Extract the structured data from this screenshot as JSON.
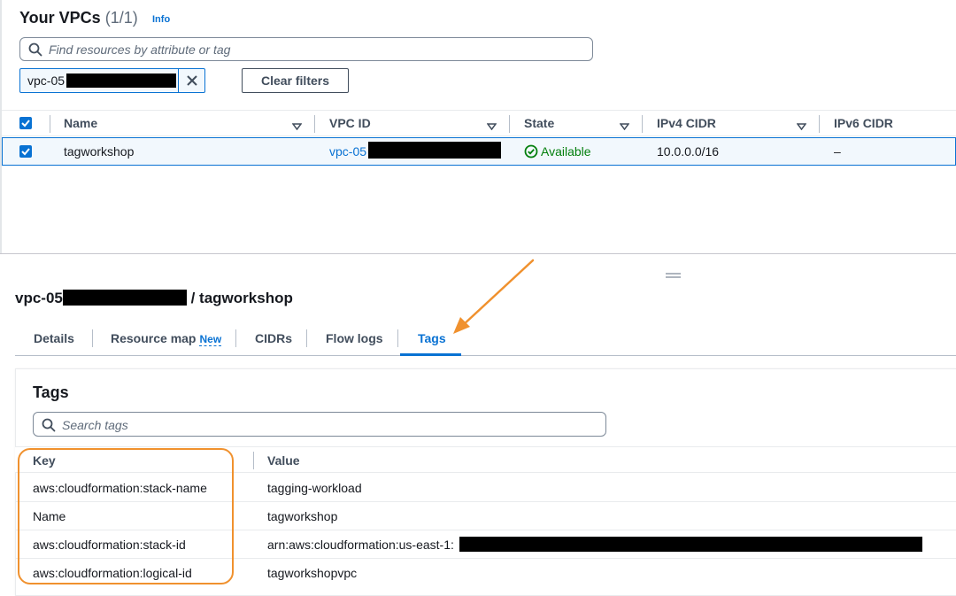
{
  "vpc_list": {
    "title": "Your VPCs",
    "count": "(1/1)",
    "info_link": "Info",
    "search_placeholder": "Find resources by attribute or tag",
    "filter_token": "vpc-05",
    "clear_filters_label": "Clear filters",
    "columns": [
      "Name",
      "VPC ID",
      "State",
      "IPv4 CIDR",
      "IPv6 CIDR"
    ],
    "rows": [
      {
        "name": "tagworkshop",
        "vpc_id": "vpc-05",
        "state": "Available",
        "ipv4_cidr": "10.0.0.0/16",
        "ipv6_cidr": "–"
      }
    ]
  },
  "details": {
    "title_prefix": "vpc-05",
    "title_suffix": "/ tagworkshop",
    "tabs": [
      {
        "label": "Details"
      },
      {
        "label": "Resource map",
        "badge": "New"
      },
      {
        "label": "CIDRs"
      },
      {
        "label": "Flow logs"
      },
      {
        "label": "Tags",
        "active": true
      }
    ]
  },
  "tags": {
    "title": "Tags",
    "search_placeholder": "Search tags",
    "columns": [
      "Key",
      "Value"
    ],
    "rows": [
      {
        "key": "aws:cloudformation:stack-name",
        "value": "tagging-workload"
      },
      {
        "key": "Name",
        "value": "tagworkshop"
      },
      {
        "key": "aws:cloudformation:stack-id",
        "value": "arn:aws:cloudformation:us-east-1:"
      },
      {
        "key": "aws:cloudformation:logical-id",
        "value": "tagworkshopvpc"
      }
    ]
  },
  "colors": {
    "link": "#0972d3",
    "success": "#037f0c",
    "annotation": "#f0912e"
  },
  "icons": [
    "search-icon",
    "close-icon",
    "checkbox-checked-icon",
    "sort-caret-icon",
    "status-available-icon",
    "drag-handle-icon",
    "annotation-arrow"
  ]
}
